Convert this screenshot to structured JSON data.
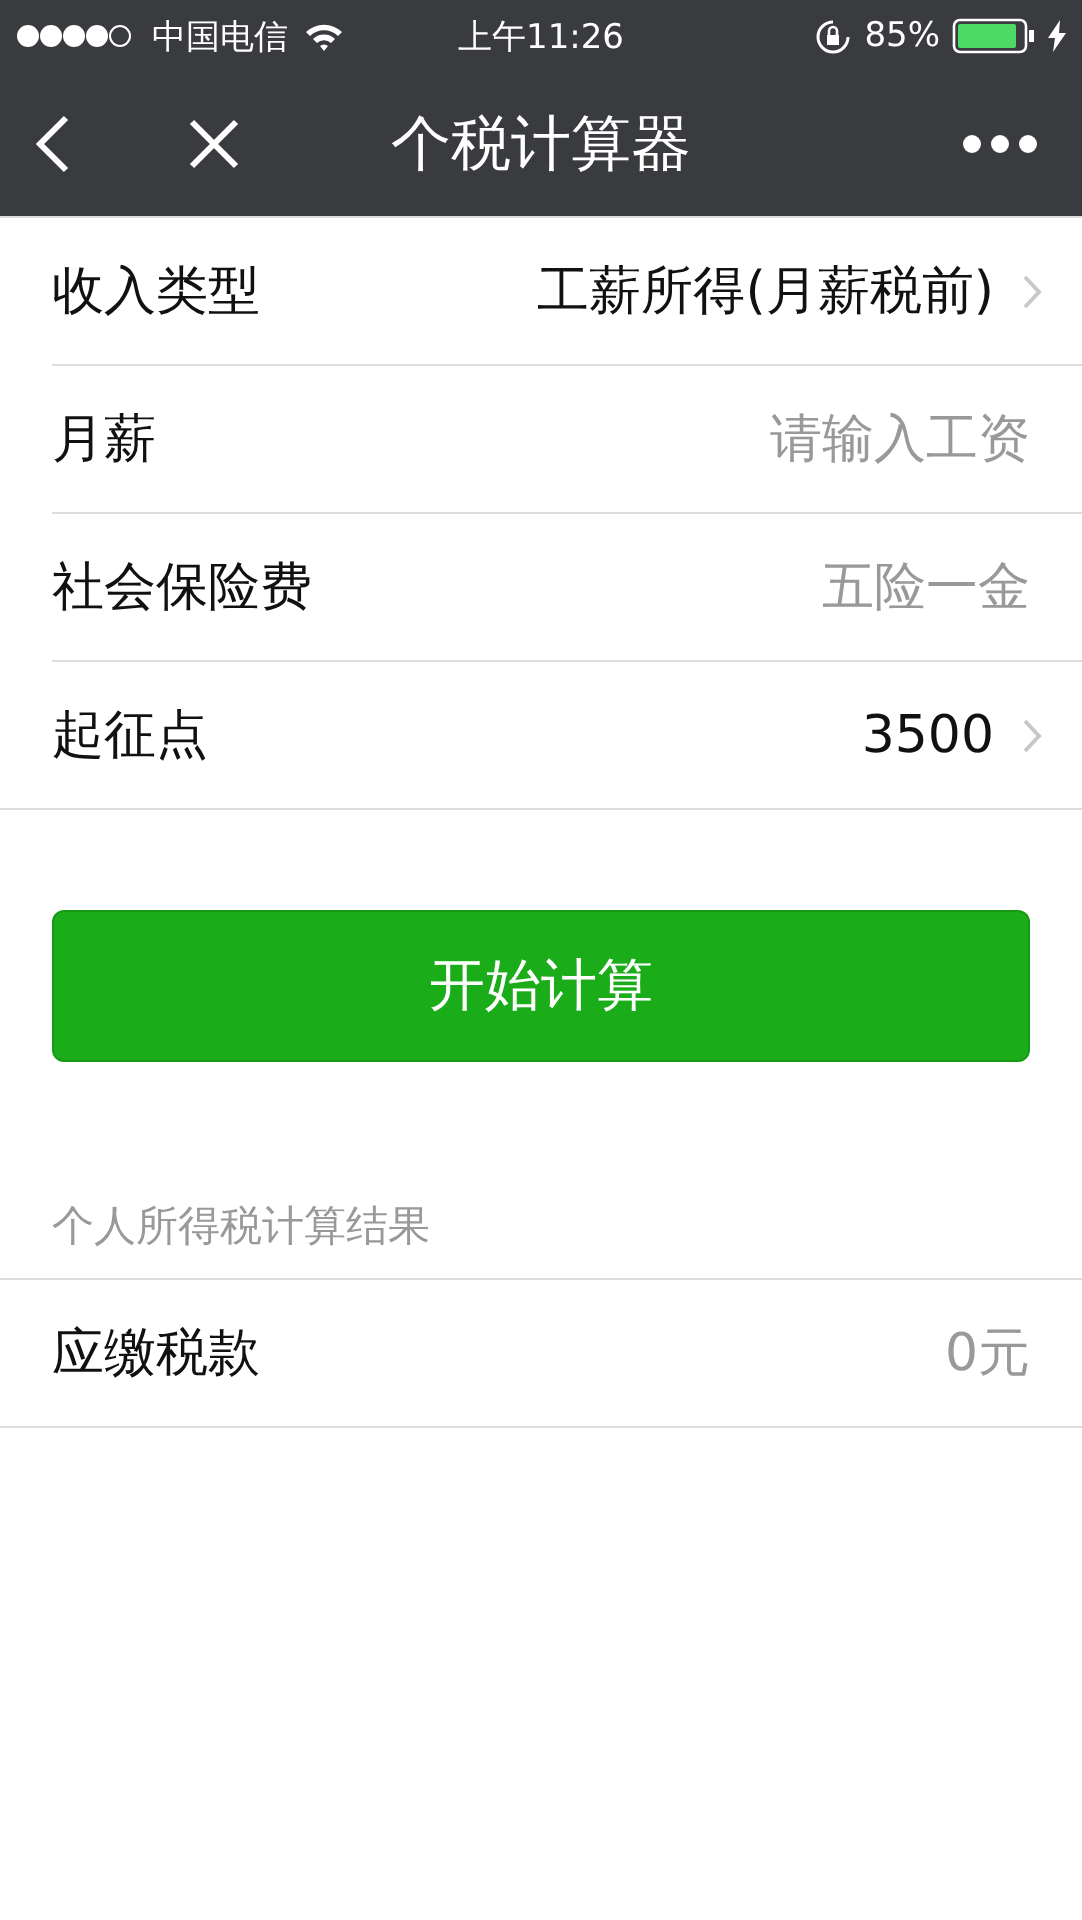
{
  "status_bar": {
    "carrier": "中国电信",
    "time": "上午11:26",
    "battery": "85%"
  },
  "nav": {
    "title": "个税计算器"
  },
  "form": [
    {
      "kind": "picker",
      "label": "收入类型",
      "value": "工薪所得(月薪税前)"
    },
    {
      "kind": "input",
      "label": "月薪",
      "placeholder": "请输入工资"
    },
    {
      "kind": "input",
      "label": "社会保险费",
      "placeholder": "五险一金"
    },
    {
      "kind": "picker",
      "label": "起征点",
      "value": "3500"
    }
  ],
  "button": "开始计算",
  "result": {
    "heading": "个人所得税计算结果",
    "label": "应缴税款",
    "value": "0元"
  }
}
